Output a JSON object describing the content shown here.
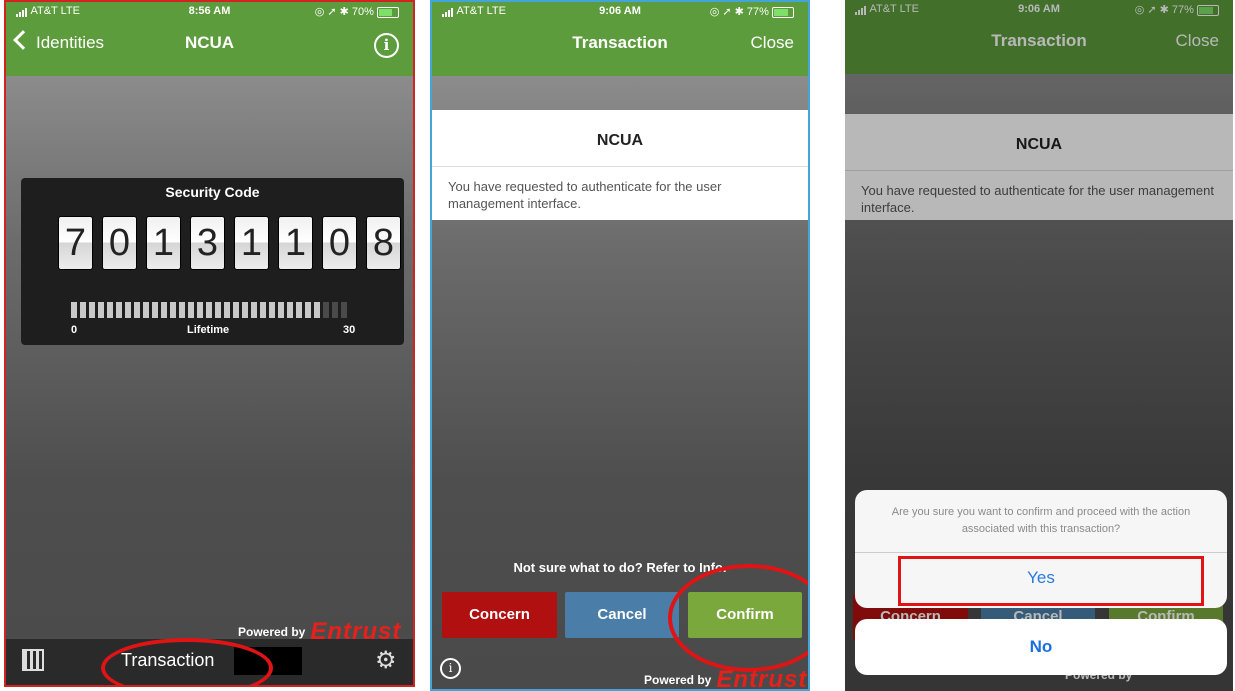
{
  "phone1": {
    "status": {
      "carrier": "AT&T  LTE",
      "time": "8:56 AM",
      "battery": "70%",
      "battery_level": 0.7
    },
    "nav": {
      "back_label": "Identities",
      "title": "NCUA"
    },
    "security": {
      "label": "Security Code",
      "digits": [
        "7",
        "0",
        "1",
        "3",
        "1",
        "1",
        "0",
        "8"
      ],
      "lifetime_label": "Lifetime",
      "lifetime_min": "0",
      "lifetime_max": "30",
      "lifetime_remaining_fraction": 0.9
    },
    "powered_by": "Powered by",
    "brand": "Entrust",
    "toolbar": {
      "transaction_label": "Transaction"
    }
  },
  "phone2": {
    "status": {
      "carrier": "AT&T  LTE",
      "time": "9:06 AM",
      "battery": "77%",
      "battery_level": 0.77
    },
    "nav": {
      "title": "Transaction",
      "close_label": "Close"
    },
    "card": {
      "title": "NCUA",
      "message": "You have requested to authenticate for the user management interface."
    },
    "hint": "Not sure what to do? Refer to Info.",
    "buttons": {
      "concern": "Concern",
      "cancel": "Cancel",
      "confirm": "Confirm"
    },
    "powered_by": "Powered by",
    "brand": "Entrust"
  },
  "phone3": {
    "status": {
      "carrier": "AT&T  LTE",
      "time": "9:06 AM",
      "battery": "77%",
      "battery_level": 0.77
    },
    "nav": {
      "title": "Transaction",
      "close_label": "Close"
    },
    "card": {
      "title": "NCUA",
      "message": "You have requested to authenticate for the user management interface."
    },
    "dialog": {
      "question": "Are you sure you want to confirm and proceed with the action associated with this transaction?",
      "yes_label": "Yes",
      "no_label": "No"
    },
    "background_buttons": {
      "concern": "Concern",
      "cancel": "Cancel",
      "confirm": "Confirm"
    },
    "powered_by": "Powered by"
  },
  "colors": {
    "nav_green": "#5c9c3c",
    "concern_red": "#b01010",
    "cancel_blue": "#4a7ea8",
    "confirm_green": "#7ba83c",
    "brand_red": "#e6211c",
    "highlight_red": "#e01414"
  }
}
